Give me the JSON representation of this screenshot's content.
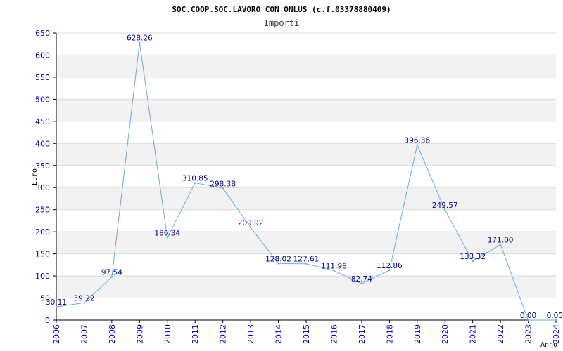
{
  "chart_data": {
    "type": "line",
    "title": "SOC.COOP.SOC.LAVORO CON ONLUS (c.f.03378880409)",
    "subtitle": "Importi",
    "xlabel": "Anno",
    "ylabel": "Euro",
    "ylim": [
      0,
      650
    ],
    "yticks": [
      0,
      50,
      100,
      150,
      200,
      250,
      300,
      350,
      400,
      450,
      500,
      550,
      600,
      650
    ],
    "grid": true,
    "x": [
      "2006",
      "2007",
      "2008",
      "2009",
      "2010",
      "2011",
      "2012",
      "2013",
      "2014",
      "2015",
      "2016",
      "2017",
      "2018",
      "2019",
      "2020",
      "2021",
      "2022",
      "2023",
      "2024"
    ],
    "series": [
      {
        "values": [
          30.11,
          39.22,
          97.54,
          628.26,
          186.34,
          310.85,
          298.38,
          209.92,
          128.02,
          127.61,
          111.98,
          82.74,
          112.86,
          396.36,
          249.57,
          133.32,
          171.0,
          0.0,
          0.0
        ],
        "labels": [
          "30.11",
          "39.22",
          "97.54",
          "628.26",
          "186.34",
          "310.85",
          "298.38",
          "209.92",
          "128.02",
          "127.61",
          "111.98",
          "82.74",
          "112.86",
          "396.36",
          "249.57",
          "133.32",
          "171.00",
          "0.00",
          "0.00"
        ],
        "color": "#6fa8dc"
      }
    ]
  },
  "colors": {
    "band": "#f2f2f2",
    "gridline": "#d9d9d9",
    "axis": "#000000",
    "tick_text": "#0000aa",
    "label_text": "#000080",
    "line": "#6fa8dc"
  }
}
